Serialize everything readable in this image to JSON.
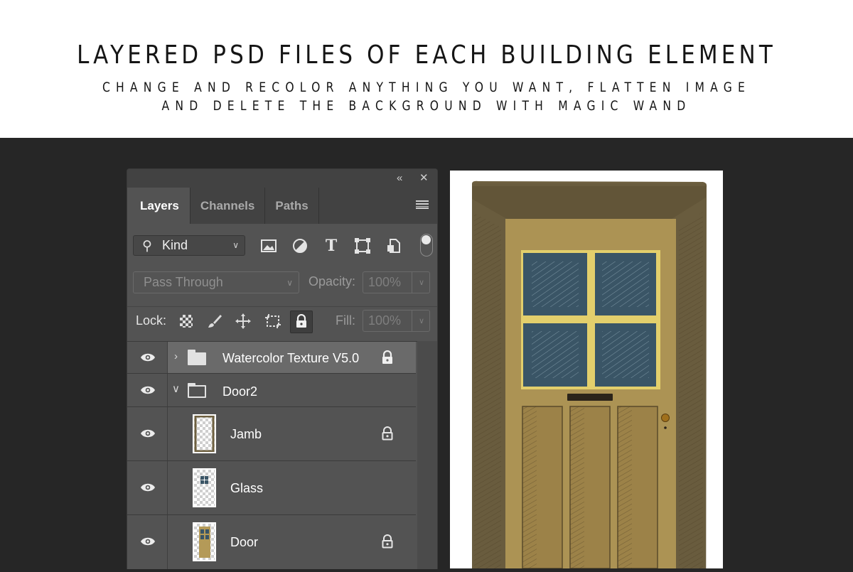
{
  "hero": {
    "title": "Layered PSD files of each building element",
    "subtitle_line1": "Change and recolor anything you want, flatten image",
    "subtitle_line2": "and delete the background with magic wand"
  },
  "panel": {
    "collapse_icon": "«",
    "close_icon": "✕",
    "tabs": [
      {
        "label": "Layers",
        "active": true
      },
      {
        "label": "Channels",
        "active": false
      },
      {
        "label": "Paths",
        "active": false
      }
    ],
    "filter": {
      "kind_label": "Kind",
      "icons": [
        "image-filter-icon",
        "adjustment-filter-icon",
        "type-filter-icon",
        "shape-filter-icon",
        "smart-object-filter-icon"
      ]
    },
    "blend": {
      "mode": "Pass Through",
      "opacity_label": "Opacity:",
      "opacity_value": "100%"
    },
    "lock": {
      "label": "Lock:",
      "fill_label": "Fill:",
      "fill_value": "100%"
    },
    "layers": [
      {
        "name": "Watercolor Texture V5.0",
        "type": "group",
        "expanded": false,
        "locked": true,
        "selected": true,
        "visible": true
      },
      {
        "name": "Door2",
        "type": "group",
        "expanded": true,
        "locked": false,
        "selected": false,
        "visible": true
      },
      {
        "name": "Jamb",
        "type": "layer",
        "locked": true,
        "selected": false,
        "visible": true
      },
      {
        "name": "Glass",
        "type": "layer",
        "locked": false,
        "selected": false,
        "visible": true
      },
      {
        "name": "Door",
        "type": "layer",
        "locked": true,
        "selected": false,
        "visible": true
      }
    ]
  },
  "colors": {
    "panel_bg": "#535353",
    "app_bg": "#262626",
    "door_wood": "#b49a58",
    "glass": "#3a5566",
    "jamb": "#6e6040"
  }
}
